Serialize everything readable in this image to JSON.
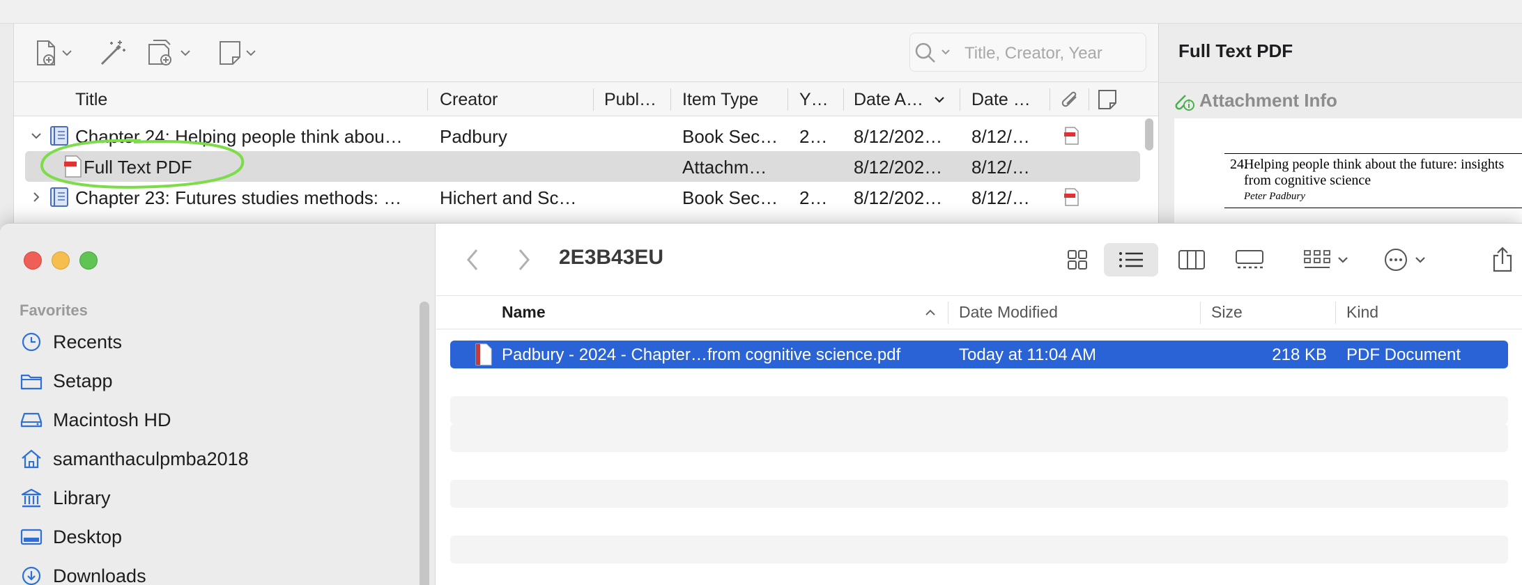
{
  "zotero": {
    "search_placeholder": "Title, Creator, Year",
    "columns": [
      "Title",
      "Creator",
      "Publ…",
      "Item Type",
      "Y…",
      "Date A…",
      "Date …"
    ],
    "rows": [
      {
        "title": "Chapter 24: Helping people think abou…",
        "creator": "Padbury",
        "item_type": "Book Sec…",
        "year": "2…",
        "date_added": "8/12/202…",
        "date_modified": "8/12/…"
      },
      {
        "title": "Full Text PDF",
        "creator": "",
        "item_type": "Attachm…",
        "year": "",
        "date_added": "8/12/202…",
        "date_modified": "8/12/…"
      },
      {
        "title": "Chapter 23: Futures studies methods: …",
        "creator": "Hichert and Sc…",
        "item_type": "Book Sec…",
        "year": "2…",
        "date_added": "8/12/202…",
        "date_modified": "8/12/…"
      }
    ],
    "right_pane": {
      "title": "Full Text PDF",
      "section": "Attachment Info",
      "preview": {
        "number": "24.",
        "title_line1": "Helping people think about the future: insights",
        "title_line2": "from cognitive science",
        "author": "Peter Padbury"
      }
    },
    "highlight_color": "#7ddc4a"
  },
  "finder": {
    "folder_title": "2E3B43EU",
    "sidebar": {
      "section_title": "Favorites",
      "items": [
        {
          "label": "Recents",
          "icon": "clock-icon"
        },
        {
          "label": "Setapp",
          "icon": "folder-icon"
        },
        {
          "label": "Macintosh HD",
          "icon": "drive-icon"
        },
        {
          "label": "samanthaculpmba2018",
          "icon": "home-icon"
        },
        {
          "label": "Library",
          "icon": "library-icon"
        },
        {
          "label": "Desktop",
          "icon": "desktop-icon"
        },
        {
          "label": "Downloads",
          "icon": "download-icon"
        }
      ]
    },
    "columns": {
      "name": "Name",
      "date_modified": "Date Modified",
      "size": "Size",
      "kind": "Kind"
    },
    "files": [
      {
        "name": "Padbury - 2024 - Chapter…from cognitive science.pdf",
        "date_modified": "Today at 11:04 AM",
        "size": "218 KB",
        "kind": "PDF Document"
      }
    ],
    "accent_color": "#2a63d6"
  }
}
